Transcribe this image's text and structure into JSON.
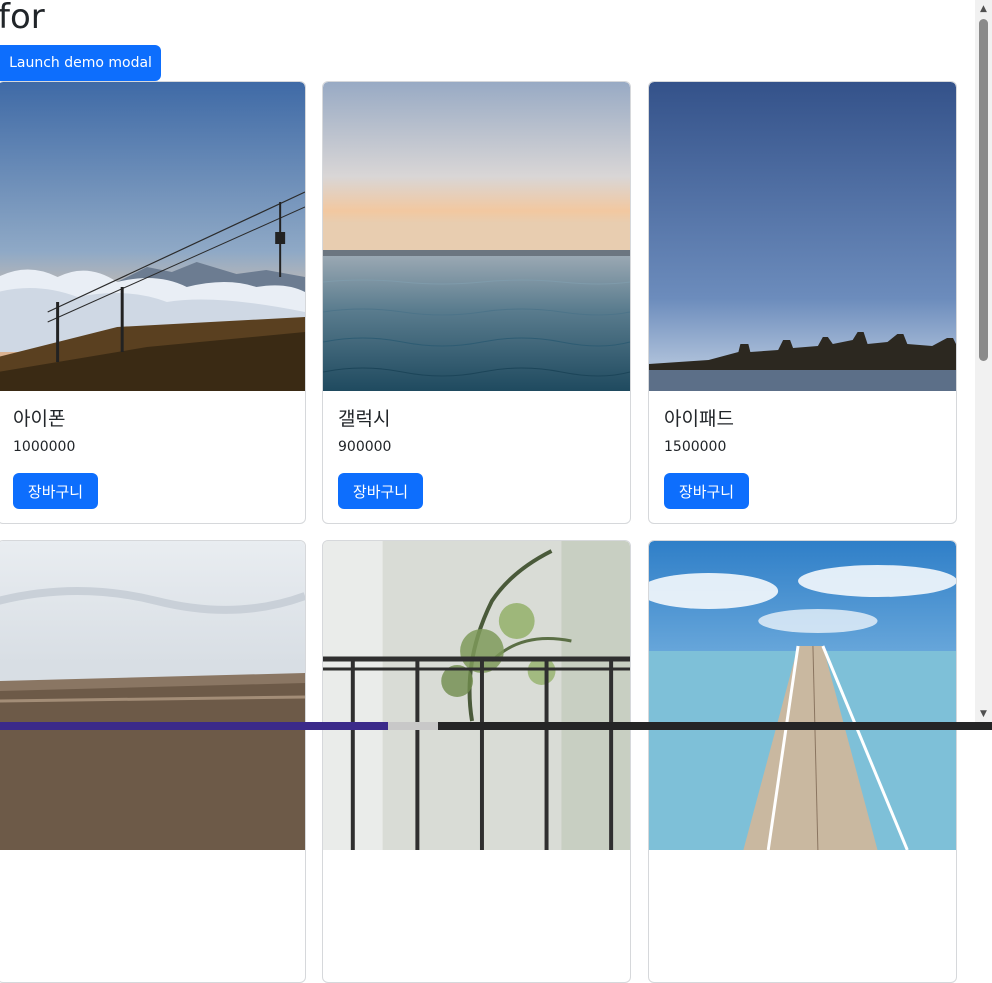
{
  "page": {
    "title": "for"
  },
  "modal_button": {
    "label": "Launch demo modal"
  },
  "products": [
    {
      "name": "아이폰",
      "price": "1000000",
      "button": "장바구니"
    },
    {
      "name": "갤럭시",
      "price": "900000",
      "button": "장바구니"
    },
    {
      "name": "아이패드",
      "price": "1500000",
      "button": "장바구니"
    }
  ],
  "theme": {
    "primary": "#0d6efd",
    "text": "#212529",
    "border": "#d6d8db"
  },
  "icons": {
    "scroll_up": "chevron-up-icon",
    "scroll_down": "chevron-down-icon"
  }
}
